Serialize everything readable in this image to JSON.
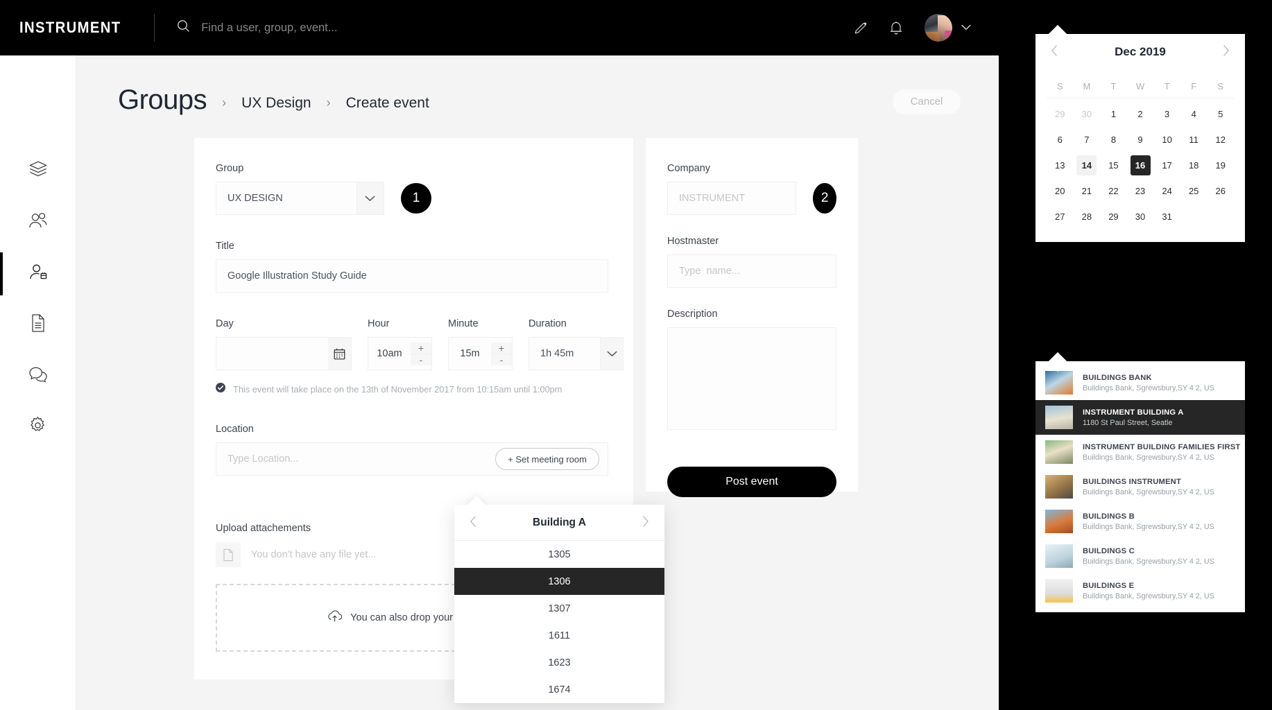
{
  "brand": "INSTRUMENT",
  "search": {
    "placeholder": "Find a user, group, event...",
    "value": "",
    "icon": "search-icon"
  },
  "topbar_icons": [
    {
      "name": "pencil-icon",
      "label": "Compose"
    },
    {
      "name": "bell-icon",
      "label": "Notifications"
    },
    {
      "name": "chevron-down-icon",
      "label": "Account menu"
    }
  ],
  "sidebar": {
    "items": [
      {
        "icon": "layers-icon",
        "label": "Dashboard",
        "active": false
      },
      {
        "icon": "users-icon",
        "label": "Groups",
        "active": false
      },
      {
        "icon": "user-calendar-icon",
        "label": "Events",
        "active": true
      },
      {
        "icon": "document-icon",
        "label": "Documents",
        "active": false
      },
      {
        "icon": "chat-icon",
        "label": "Messages",
        "active": false
      },
      {
        "icon": "gear-icon",
        "label": "Settings",
        "active": false
      }
    ]
  },
  "header": {
    "title": "Groups",
    "breadcrumbs": [
      "UX Design",
      "Create event"
    ],
    "separator": "›",
    "cancel_label": "Cancel"
  },
  "form": {
    "group": {
      "label": "Group",
      "value": "UX DESIGN",
      "badge": "1",
      "options": [
        "UX DESIGN"
      ]
    },
    "title": {
      "label": "Title",
      "value": "Google Illustration Study Guide",
      "placeholder": ""
    },
    "day": {
      "label": "Day",
      "value": "",
      "placeholder": "",
      "icon": "calendar-icon"
    },
    "hour": {
      "label": "Hour",
      "value": "10am",
      "plus": "+",
      "minus": "-"
    },
    "minute": {
      "label": "Minute",
      "value": "15m",
      "plus": "+",
      "minus": "-"
    },
    "duration": {
      "label": "Duration",
      "value": "1h 45m",
      "options": [
        "1h 45m"
      ]
    },
    "notice": {
      "icon": "check-circle-icon",
      "text": "This event will take place on the 13th of November 2017 from 10:15am until 1:00pm"
    },
    "location": {
      "label": "Location",
      "placeholder": "Type Location...",
      "value": "",
      "set_room_label": "+ Set meeting room"
    },
    "upload": {
      "label": "Upload attachements",
      "empty_text": "You don't have any file yet...",
      "file_icon": "file-icon",
      "drop_text": "You can also drop your files here",
      "drop_icon": "upload-cloud-icon"
    },
    "company": {
      "label": "Company",
      "placeholder": "INSTRUMENT",
      "value": "",
      "badge": "2"
    },
    "hostmaster": {
      "label": "Hostmaster",
      "placeholder": "Type  name...",
      "value": ""
    },
    "description": {
      "label": "Description",
      "placeholder": "",
      "value": ""
    },
    "post_label": "Post event"
  },
  "rooms_popover": {
    "title": "Building A",
    "prev_icon": "chevron-left-icon",
    "next_icon": "chevron-right-icon",
    "items": [
      "1305",
      "1306",
      "1307",
      "1611",
      "1623",
      "1674"
    ],
    "selected": "1306"
  },
  "calendar": {
    "month_label": "Dec 2019",
    "prev_icon": "chevron-left-icon",
    "next_icon": "chevron-right-icon",
    "dow": [
      "S",
      "M",
      "T",
      "W",
      "T",
      "F",
      "S"
    ],
    "weeks": [
      [
        {
          "d": "29",
          "mute": true
        },
        {
          "d": "30",
          "mute": true
        },
        {
          "d": "1"
        },
        {
          "d": "2"
        },
        {
          "d": "3"
        },
        {
          "d": "4"
        },
        {
          "d": "5"
        }
      ],
      [
        {
          "d": "6"
        },
        {
          "d": "7"
        },
        {
          "d": "8"
        },
        {
          "d": "9"
        },
        {
          "d": "10"
        },
        {
          "d": "11"
        },
        {
          "d": "12"
        }
      ],
      [
        {
          "d": "13"
        },
        {
          "d": "14",
          "hover": true
        },
        {
          "d": "15"
        },
        {
          "d": "16",
          "selected": true
        },
        {
          "d": "17"
        },
        {
          "d": "18"
        },
        {
          "d": "19"
        }
      ],
      [
        {
          "d": "20"
        },
        {
          "d": "21"
        },
        {
          "d": "22"
        },
        {
          "d": "23"
        },
        {
          "d": "24"
        },
        {
          "d": "25"
        },
        {
          "d": "26"
        }
      ],
      [
        {
          "d": "27"
        },
        {
          "d": "28"
        },
        {
          "d": "29"
        },
        {
          "d": "30"
        },
        {
          "d": "31"
        },
        {
          "d": ""
        },
        {
          "d": ""
        }
      ]
    ],
    "selected_day": "16",
    "hover_day": "14"
  },
  "buildings_popover": {
    "items": [
      {
        "name": "BUILDINGS BANK",
        "address": "Buildings Bank, Sgrewsbury,SY 4 2, US",
        "thumb": "t1",
        "selected": false
      },
      {
        "name": "INSTRUMENT BUILDING A",
        "address": "1180 St Paul Street, Seatle",
        "thumb": "t2",
        "selected": true
      },
      {
        "name": "INSTRUMENT BUILDING FAMILIES FIRST",
        "address": "Buildings Bank, Sgrewsbury,SY 4 2, US",
        "thumb": "t3",
        "selected": false
      },
      {
        "name": "BUILDINGS INSTRUMENT",
        "address": "Buildings Bank, Sgrewsbury,SY 4 2, US",
        "thumb": "t4",
        "selected": false
      },
      {
        "name": "BUILDINGS B",
        "address": "Buildings Bank, Sgrewsbury,SY 4 2, US",
        "thumb": "t5",
        "selected": false
      },
      {
        "name": "BUILDINGS C",
        "address": "Buildings Bank, Sgrewsbury,SY 4 2, US",
        "thumb": "t6",
        "selected": false
      },
      {
        "name": "BUILDINGS E",
        "address": "Buildings Bank, Sgrewsbury,SY 4 2, US",
        "thumb": "t7",
        "selected": false
      }
    ]
  },
  "colors": {
    "accent": "#000000",
    "selected_row": "#262626",
    "page_bg": "#f4f4f4",
    "card_bg": "#ffffff",
    "label": "#3d4450",
    "muted": "#c6c6c6",
    "notice": "#a8aeb8"
  }
}
